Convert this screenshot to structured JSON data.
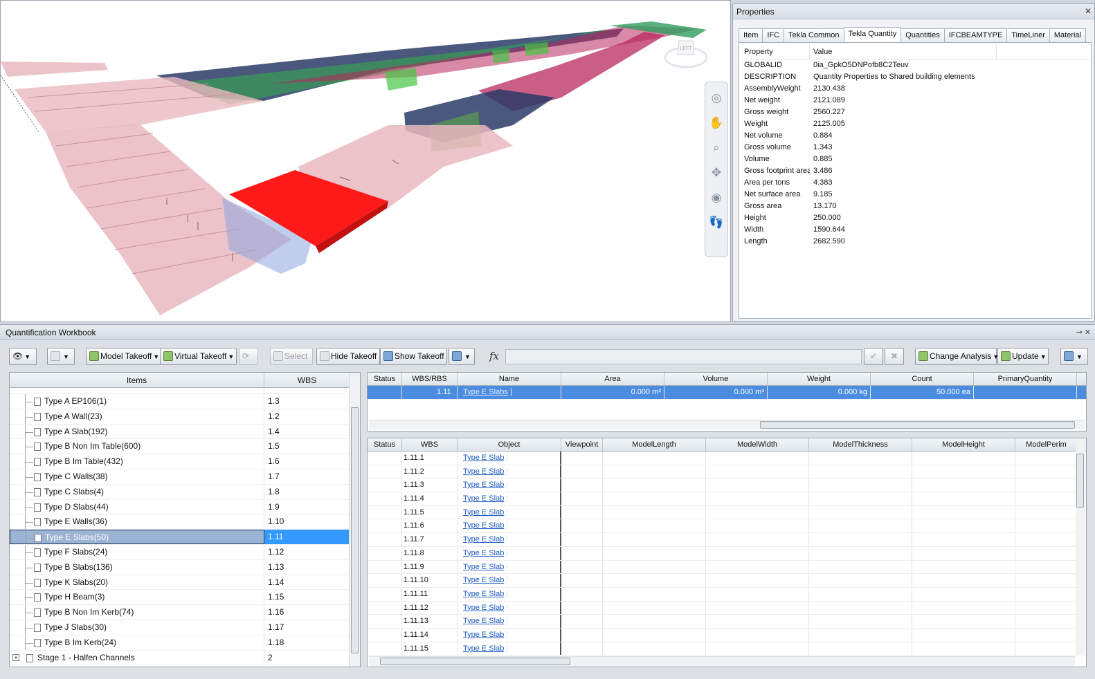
{
  "properties": {
    "title": "Properties",
    "tabs": [
      "Item",
      "IFC",
      "Tekla Common",
      "Tekla Quantity",
      "Quantities",
      "IFCBEAMTYPE",
      "TimeLiner",
      "Material"
    ],
    "active_tab": "Tekla Quantity",
    "columns": [
      "Property",
      "Value"
    ],
    "rows": [
      {
        "k": "GLOBALID",
        "v": "0ia_GpkO5DNPofb8C2Teuv"
      },
      {
        "k": "DESCRIPTION",
        "v": "Quantity Properties to Shared building elements"
      },
      {
        "k": "AssemblyWeight",
        "v": "2130.438"
      },
      {
        "k": "Net weight",
        "v": "2121.089"
      },
      {
        "k": "Gross weight",
        "v": "2560.227"
      },
      {
        "k": "Weight",
        "v": "2125.005"
      },
      {
        "k": "Net volume",
        "v": "0.884"
      },
      {
        "k": "Gross volume",
        "v": "1.343"
      },
      {
        "k": "Volume",
        "v": "0.885"
      },
      {
        "k": "Gross footprint area",
        "v": "3.486"
      },
      {
        "k": "Area per tons",
        "v": "4.383"
      },
      {
        "k": "Net surface area",
        "v": "9.185"
      },
      {
        "k": "Gross area",
        "v": "13.170"
      },
      {
        "k": "Height",
        "v": "250.000"
      },
      {
        "k": "Width",
        "v": "1590.644"
      },
      {
        "k": "Length",
        "v": "2682.590"
      }
    ]
  },
  "viewport": {
    "viewcube_label": "LEFT"
  },
  "workbook": {
    "title": "Quantification Workbook",
    "toolbar": {
      "model_takeoff": "Model Takeoff",
      "virtual_takeoff": "Virtual Takeoff",
      "select": "Select",
      "hide_takeoff": "Hide Takeoff",
      "show_takeoff": "Show Takeoff",
      "change_analysis": "Change Analysis",
      "update": "Update",
      "fx": "fx"
    },
    "items_columns": [
      "Items",
      "WBS"
    ],
    "items": [
      {
        "name": "Type A EP106(1)",
        "wbs": "1.3"
      },
      {
        "name": "Type A Wall(23)",
        "wbs": "1.2"
      },
      {
        "name": "Type A Slab(192)",
        "wbs": "1.4"
      },
      {
        "name": "Type B Non Im Table(600)",
        "wbs": "1.5"
      },
      {
        "name": "Type B Im Table(432)",
        "wbs": "1.6"
      },
      {
        "name": "Type C Walls(38)",
        "wbs": "1.7"
      },
      {
        "name": "Type C Slabs(4)",
        "wbs": "1.8"
      },
      {
        "name": "Type D Slabs(44)",
        "wbs": "1.9"
      },
      {
        "name": "Type E Walls(36)",
        "wbs": "1.10"
      },
      {
        "name": "Type E Slabs(50)",
        "wbs": "1.11",
        "selected": true
      },
      {
        "name": "Type F Slabs(24)",
        "wbs": "1.12"
      },
      {
        "name": "Type B Slabs(136)",
        "wbs": "1.13"
      },
      {
        "name": "Type K Slabs(20)",
        "wbs": "1.14"
      },
      {
        "name": "Type H Beam(3)",
        "wbs": "1.15"
      },
      {
        "name": "Type B Non Im Kerb(74)",
        "wbs": "1.16"
      },
      {
        "name": "Type J Slabs(30)",
        "wbs": "1.17"
      },
      {
        "name": "Type B Im Kerb(24)",
        "wbs": "1.18"
      }
    ],
    "stage_row": {
      "name": "Stage 1 - Halfen Channels",
      "wbs": "2"
    },
    "group_columns": [
      "Status",
      "WBS/RBS",
      "Name",
      "Area",
      "Volume",
      "Weight",
      "Count",
      "PrimaryQuantity"
    ],
    "group_row": {
      "status": "",
      "wbs": "1.11",
      "name": "Type E Slabs",
      "area": "0.000 m²",
      "volume": "0.000 m³",
      "weight": "0.000 kg",
      "count": "50.000 ea",
      "primary": ""
    },
    "object_columns": [
      "Status",
      "WBS",
      "Object",
      "Viewpoint",
      "ModelLength",
      "ModelWidth",
      "ModelThickness",
      "ModelHeight",
      "ModelPerim"
    ],
    "object_rows": [
      {
        "wbs": "1.11.1",
        "object": "Type E Slab"
      },
      {
        "wbs": "1.11.2",
        "object": "Type E Slab"
      },
      {
        "wbs": "1.11.3",
        "object": "Type E Slab"
      },
      {
        "wbs": "1.11.4",
        "object": "Type E Slab"
      },
      {
        "wbs": "1.11.5",
        "object": "Type E Slab"
      },
      {
        "wbs": "1.11.6",
        "object": "Type E Slab"
      },
      {
        "wbs": "1.11.7",
        "object": "Type E Slab"
      },
      {
        "wbs": "1.11.8",
        "object": "Type E Slab"
      },
      {
        "wbs": "1.11.9",
        "object": "Type E Slab"
      },
      {
        "wbs": "1.11.10",
        "object": "Type E Slab"
      },
      {
        "wbs": "1.11.11",
        "object": "Type E Slab"
      },
      {
        "wbs": "1.11.12",
        "object": "Type E Slab"
      },
      {
        "wbs": "1.11.13",
        "object": "Type E Slab"
      },
      {
        "wbs": "1.11.14",
        "object": "Type E Slab"
      },
      {
        "wbs": "1.11.15",
        "object": "Type E Slab"
      }
    ]
  },
  "colors": {
    "highlight_red": "#ff1a1a",
    "slab_pink": "#e9b9be",
    "dark_blue": "#2a3b66",
    "magenta": "#b8285c",
    "green": "#33b04a",
    "selection_blue": "#3399ff"
  }
}
